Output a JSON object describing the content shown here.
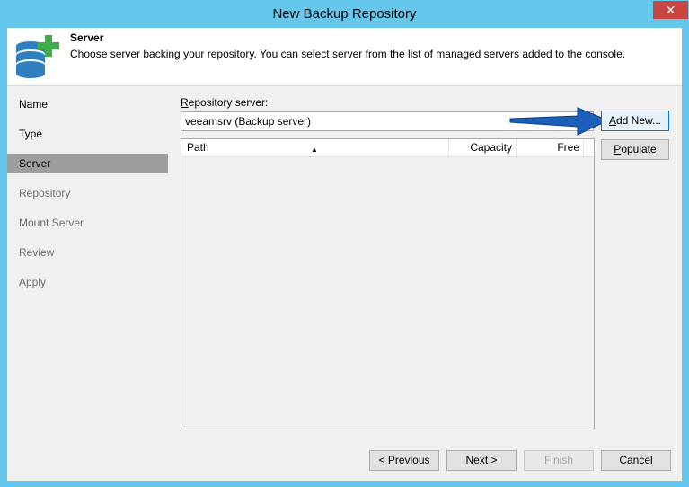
{
  "window": {
    "title": "New Backup Repository",
    "close_symbol": "✕"
  },
  "header": {
    "title": "Server",
    "description": "Choose server backing your repository. You can select server from the list of managed servers added to the console.",
    "icon": "database-add-icon"
  },
  "nav": {
    "items": [
      {
        "label": "Name",
        "state": "normal"
      },
      {
        "label": "Type",
        "state": "normal"
      },
      {
        "label": "Server",
        "state": "active"
      },
      {
        "label": "Repository",
        "state": "disabled"
      },
      {
        "label": "Mount Server",
        "state": "disabled"
      },
      {
        "label": "Review",
        "state": "disabled"
      },
      {
        "label": "Apply",
        "state": "disabled"
      }
    ]
  },
  "repository": {
    "label_accel": "R",
    "label_rest": "epository server:",
    "server_value": "veeamsrv (Backup server)",
    "add_new_accel": "A",
    "add_new_rest": "dd New...",
    "populate_accel": "P",
    "populate_rest": "opulate"
  },
  "grid": {
    "columns": [
      "Path",
      "Capacity",
      "Free"
    ],
    "sort_indicator": "▲",
    "rows": []
  },
  "footer": {
    "previous_prefix": "< ",
    "previous_accel": "P",
    "previous_rest": "revious",
    "next_accel": "N",
    "next_rest": "ext >",
    "finish_label": "Finish",
    "cancel_label": "Cancel"
  },
  "colors": {
    "window_frame": "#65c7ec",
    "active_nav": "#9e9e9e",
    "arrow_blue": "#1b5fb8",
    "close_red": "#c7463f",
    "icon_green": "#3fae49",
    "icon_blue": "#2f7fc1"
  }
}
